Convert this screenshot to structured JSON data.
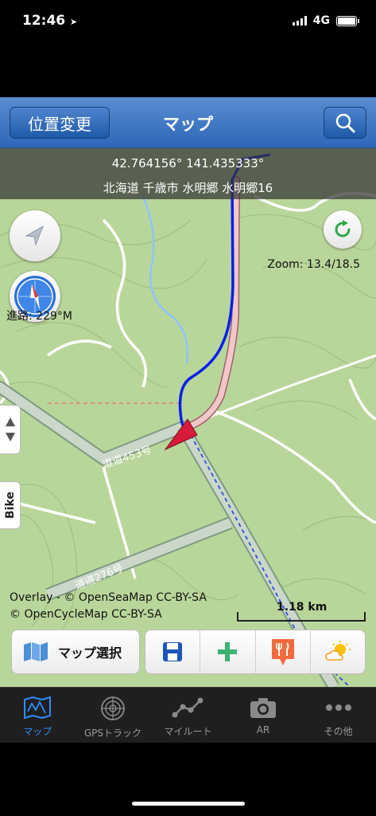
{
  "status": {
    "time": "12:46",
    "network": "4G",
    "icons": [
      "location-arrow-icon",
      "signal-bars-icon",
      "battery-icon"
    ]
  },
  "navbar": {
    "left_button": "位置変更",
    "title": "マップ",
    "right_button_icon": "search-icon"
  },
  "map": {
    "coordinates": "42.764156° 141.435333°",
    "address": "北海道 千歳市 水明郷 水明郷16",
    "heading": "進路: 229°M",
    "zoom": "Zoom: 13.4/18.5",
    "road_labels": [
      "道道453号",
      "道道276号"
    ],
    "attribution_line1": "Overlay - © OpenSeaMap CC-BY-SA",
    "attribution_line2": "© OpenCycleMap CC-BY-SA",
    "scale_label": "1.18 km",
    "side_tab_bike": "Bike",
    "colors": {
      "terrain": "#b9d69a",
      "track": "#0a1ef0",
      "route": "#f2c7c7",
      "marker": "#d81b3a"
    }
  },
  "toolbar": {
    "map_select_label": "マップ選択",
    "tools": [
      "save-icon",
      "add-icon",
      "restaurant-pin-icon",
      "weather-icon"
    ]
  },
  "tabbar": {
    "tabs": [
      {
        "label": "マップ",
        "icon": "map-icon",
        "active": true
      },
      {
        "label": "GPSトラック",
        "icon": "radar-icon",
        "active": false
      },
      {
        "label": "マイルート",
        "icon": "route-icon",
        "active": false
      },
      {
        "label": "AR",
        "icon": "camera-icon",
        "active": false
      },
      {
        "label": "その他",
        "icon": "more-icon",
        "active": false
      }
    ]
  }
}
